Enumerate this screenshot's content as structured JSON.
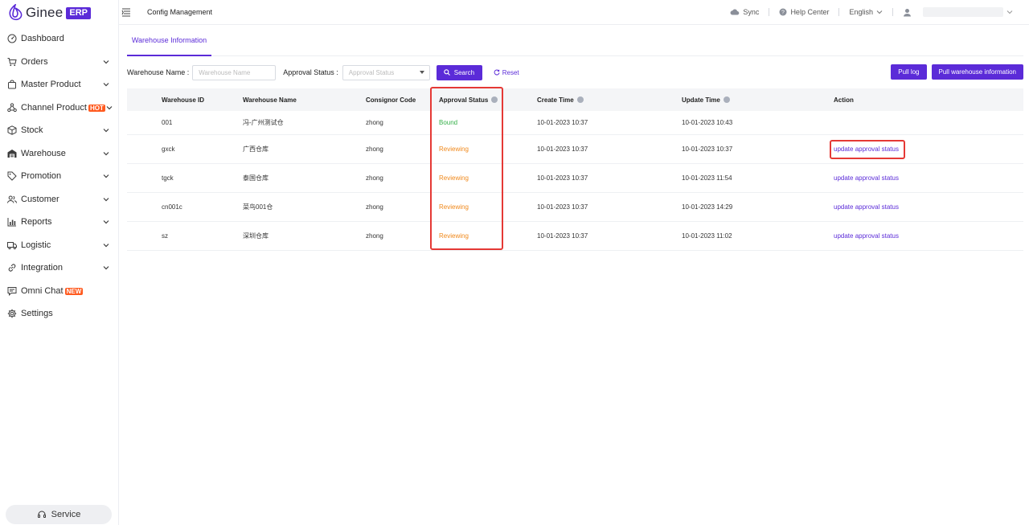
{
  "brand": {
    "name": "Ginee",
    "badge": "ERP",
    "accent": "#5b2bd8"
  },
  "sidebar": {
    "items": [
      {
        "label": "Dashboard",
        "icon": "dashboard-icon",
        "expandable": false
      },
      {
        "label": "Orders",
        "icon": "cart-icon",
        "expandable": true
      },
      {
        "label": "Master Product",
        "icon": "bag-icon",
        "expandable": true
      },
      {
        "label": "Channel Product",
        "icon": "channel-icon",
        "expandable": true,
        "tag": "HOT"
      },
      {
        "label": "Stock",
        "icon": "box-icon",
        "expandable": true
      },
      {
        "label": "Warehouse",
        "icon": "warehouse-icon",
        "expandable": true
      },
      {
        "label": "Promotion",
        "icon": "tag-icon",
        "expandable": true
      },
      {
        "label": "Customer",
        "icon": "people-icon",
        "expandable": true
      },
      {
        "label": "Reports",
        "icon": "bar-chart-icon",
        "expandable": true
      },
      {
        "label": "Logistic",
        "icon": "truck-icon",
        "expandable": true
      },
      {
        "label": "Integration",
        "icon": "link-icon",
        "expandable": true
      },
      {
        "label": "Omni Chat",
        "icon": "chat-icon",
        "expandable": false,
        "tag": "NEW"
      },
      {
        "label": "Settings",
        "icon": "gear-icon",
        "expandable": false
      }
    ],
    "service_label": "Service"
  },
  "topbar": {
    "breadcrumb": "Config Management",
    "sync_label": "Sync",
    "help_label": "Help Center",
    "language": "English"
  },
  "tabs": [
    {
      "label": "Warehouse Information",
      "active": true
    }
  ],
  "filters": {
    "warehouse_name_label": "Warehouse Name :",
    "warehouse_name_placeholder": "Warehouse Name",
    "warehouse_name_value": "",
    "approval_status_label": "Approval Status :",
    "approval_status_placeholder": "Approval Status",
    "search_label": "Search",
    "reset_label": "Reset",
    "pull_log_label": "Pull log",
    "pull_warehouse_label": "Pull warehouse information"
  },
  "table": {
    "columns": [
      "Warehouse ID",
      "Warehouse Name",
      "Consignor Code",
      "Approval Status",
      "Create Time",
      "Update Time",
      "Action"
    ],
    "rows": [
      {
        "id": "001",
        "name": "冯-广州测试仓",
        "consignor": "zhong",
        "status": "Bound",
        "status_kind": "bound",
        "create": "10-01-2023 10:37",
        "update": "10-01-2023 10:43",
        "action": ""
      },
      {
        "id": "gxck",
        "name": "广西仓库",
        "consignor": "zhong",
        "status": "Reviewing",
        "status_kind": "review",
        "create": "10-01-2023 10:37",
        "update": "10-01-2023 10:37",
        "action": "update approval status"
      },
      {
        "id": "tgck",
        "name": "泰国仓库",
        "consignor": "zhong",
        "status": "Reviewing",
        "status_kind": "review",
        "create": "10-01-2023 10:37",
        "update": "10-01-2023 11:54",
        "action": "update approval status"
      },
      {
        "id": "cn001c",
        "name": "菜鸟001仓",
        "consignor": "zhong",
        "status": "Reviewing",
        "status_kind": "review",
        "create": "10-01-2023 10:37",
        "update": "10-01-2023 14:29",
        "action": "update approval status"
      },
      {
        "id": "sz",
        "name": "深圳仓库",
        "consignor": "zhong",
        "status": "Reviewing",
        "status_kind": "review",
        "create": "10-01-2023 10:37",
        "update": "10-01-2023 11:02",
        "action": "update approval status"
      }
    ]
  },
  "colors": {
    "bound": "#36b04a",
    "reviewing": "#f0881a",
    "highlight": "#e53935"
  }
}
